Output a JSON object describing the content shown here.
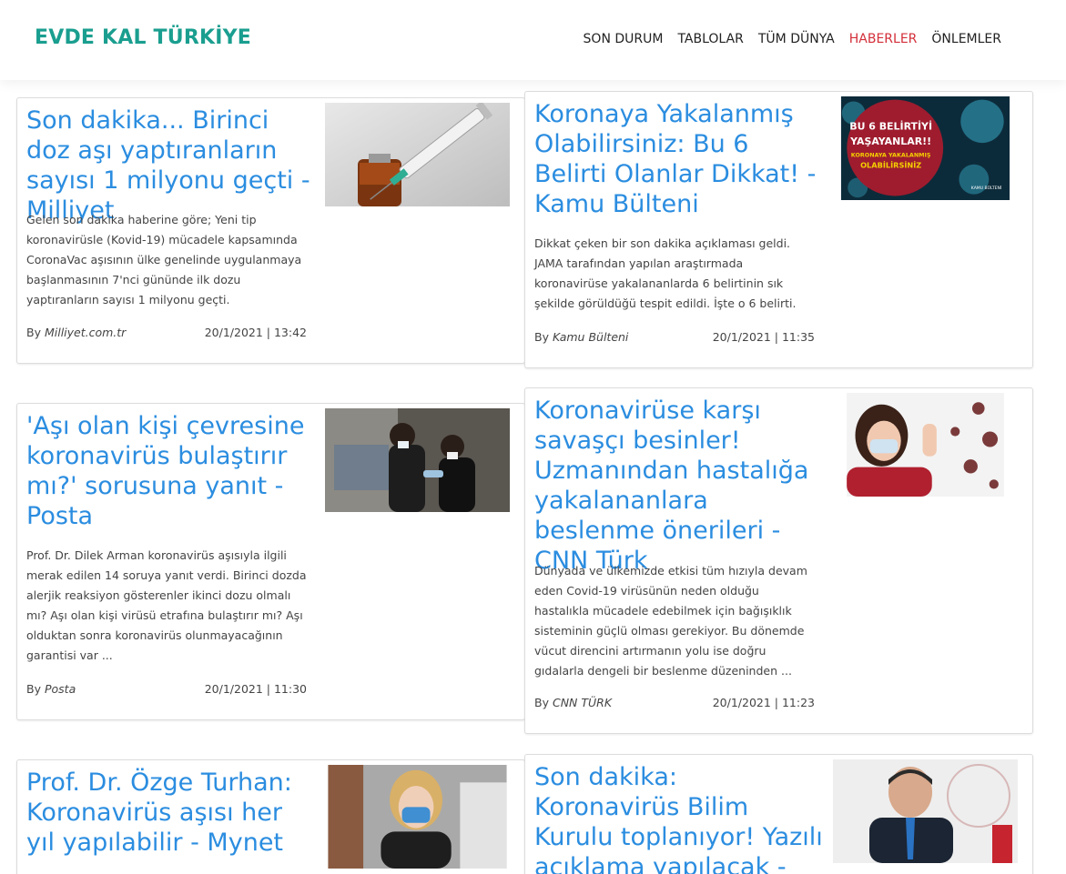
{
  "brand": "EVDE KAL TÜRKİYE",
  "nav": [
    "SON DURUM",
    "TABLOLAR",
    "TÜM DÜNYA",
    "HABERLER",
    "ÖNLEMLER"
  ],
  "active_nav": "HABERLER",
  "colors": {
    "brand": "#1a9e8f",
    "title_link": "#2b8de0",
    "active_nav": "#d32f3a"
  },
  "by_label": "By",
  "articles": [
    {
      "title": "Son dakika... Birinci doz aşı yaptıranların sayısı 1 milyonu geçti - Milliyet",
      "description": "Gelen son dakika haberine göre; Yeni tip koronavirüsle (Kovid-19) mücadele kapsamında CoronaVac aşısının ülke genelinde uygulanmaya başlanmasının 7'nci gününde ilk dozu yaptıranların sayısı 1 milyonu geçti.",
      "source": "Milliyet.com.tr",
      "datetime": "20/1/2021 | 13:42",
      "image": "syringe-vial-photo"
    },
    {
      "title": "Koronaya Yakalanmış Olabilirsiniz: Bu 6 Belirti Olanlar Dikkat! - Kamu Bülteni",
      "description": "Dikkat çeken bir son dakika açıklaması geldi. JAMA tarafından yapılan araştırmada koronavirüse yakalananlarda 6 belirtinin sık şekilde görüldüğü tespit edildi. İşte o 6 belirti.",
      "source": "Kamu Bülteni",
      "datetime": "20/1/2021 | 11:35",
      "image": "virus-warning-graphic",
      "image_text": [
        "BU 6 BELİRTİYİ",
        "YAŞAYANLAR!!",
        "KORONAYA YAKALANMIŞ",
        "OLABİLİRSİNİZ",
        "KAMU BÜLTENİ"
      ]
    },
    {
      "title": "'Aşı olan kişi çevresine koronavirüs bulaştırır mı?' sorusuna yanıt - Posta",
      "description": "Prof. Dr. Dilek Arman koronavirüs aşısıyla ilgili merak edilen 14 soruya yanıt verdi. Birinci dozda alerjik reaksiyon gösterenler ikinci dozu olmalı mı? Aşı olan kişi virüsü etrafına bulaştırır mı? Aşı olduktan sonra koronavirüs olunmayacağının garantisi var ...",
      "source": "Posta",
      "datetime": "20/1/2021 | 11:30",
      "image": "vaccination-photo"
    },
    {
      "title": "Koronavirüse karşı savaşçı besinler! Uzmanından hastalığa yakalananlara beslenme önerileri - CNN Türk",
      "description": "Dünyada ve ülkemizde etkisi tüm hızıyla devam eden Covid-19 virüsünün neden olduğu hastalıkla mücadele edebilmek için bağışıklık sisteminin güçlü olması gerekiyor. Bu dönemde vücut direncini artırmanın yolu ise doğru gıdalarla dengeli bir beslenme düzeninden ...",
      "source": "CNN TÜRK",
      "datetime": "20/1/2021 | 11:23",
      "image": "woman-mask-virus-photo"
    },
    {
      "title": "Prof. Dr. Özge Turhan: Koronavirüs aşısı her yıl yapılabilir - Mynet",
      "description": "",
      "source": "",
      "datetime": "",
      "image": "doctor-mask-photo"
    },
    {
      "title": "Son dakika: Koronavirüs Bilim Kurulu toplanıyor! Yazılı açıklama yapılacak - Hürriyet",
      "description": "",
      "source": "",
      "datetime": "",
      "image": "minister-photo"
    }
  ]
}
